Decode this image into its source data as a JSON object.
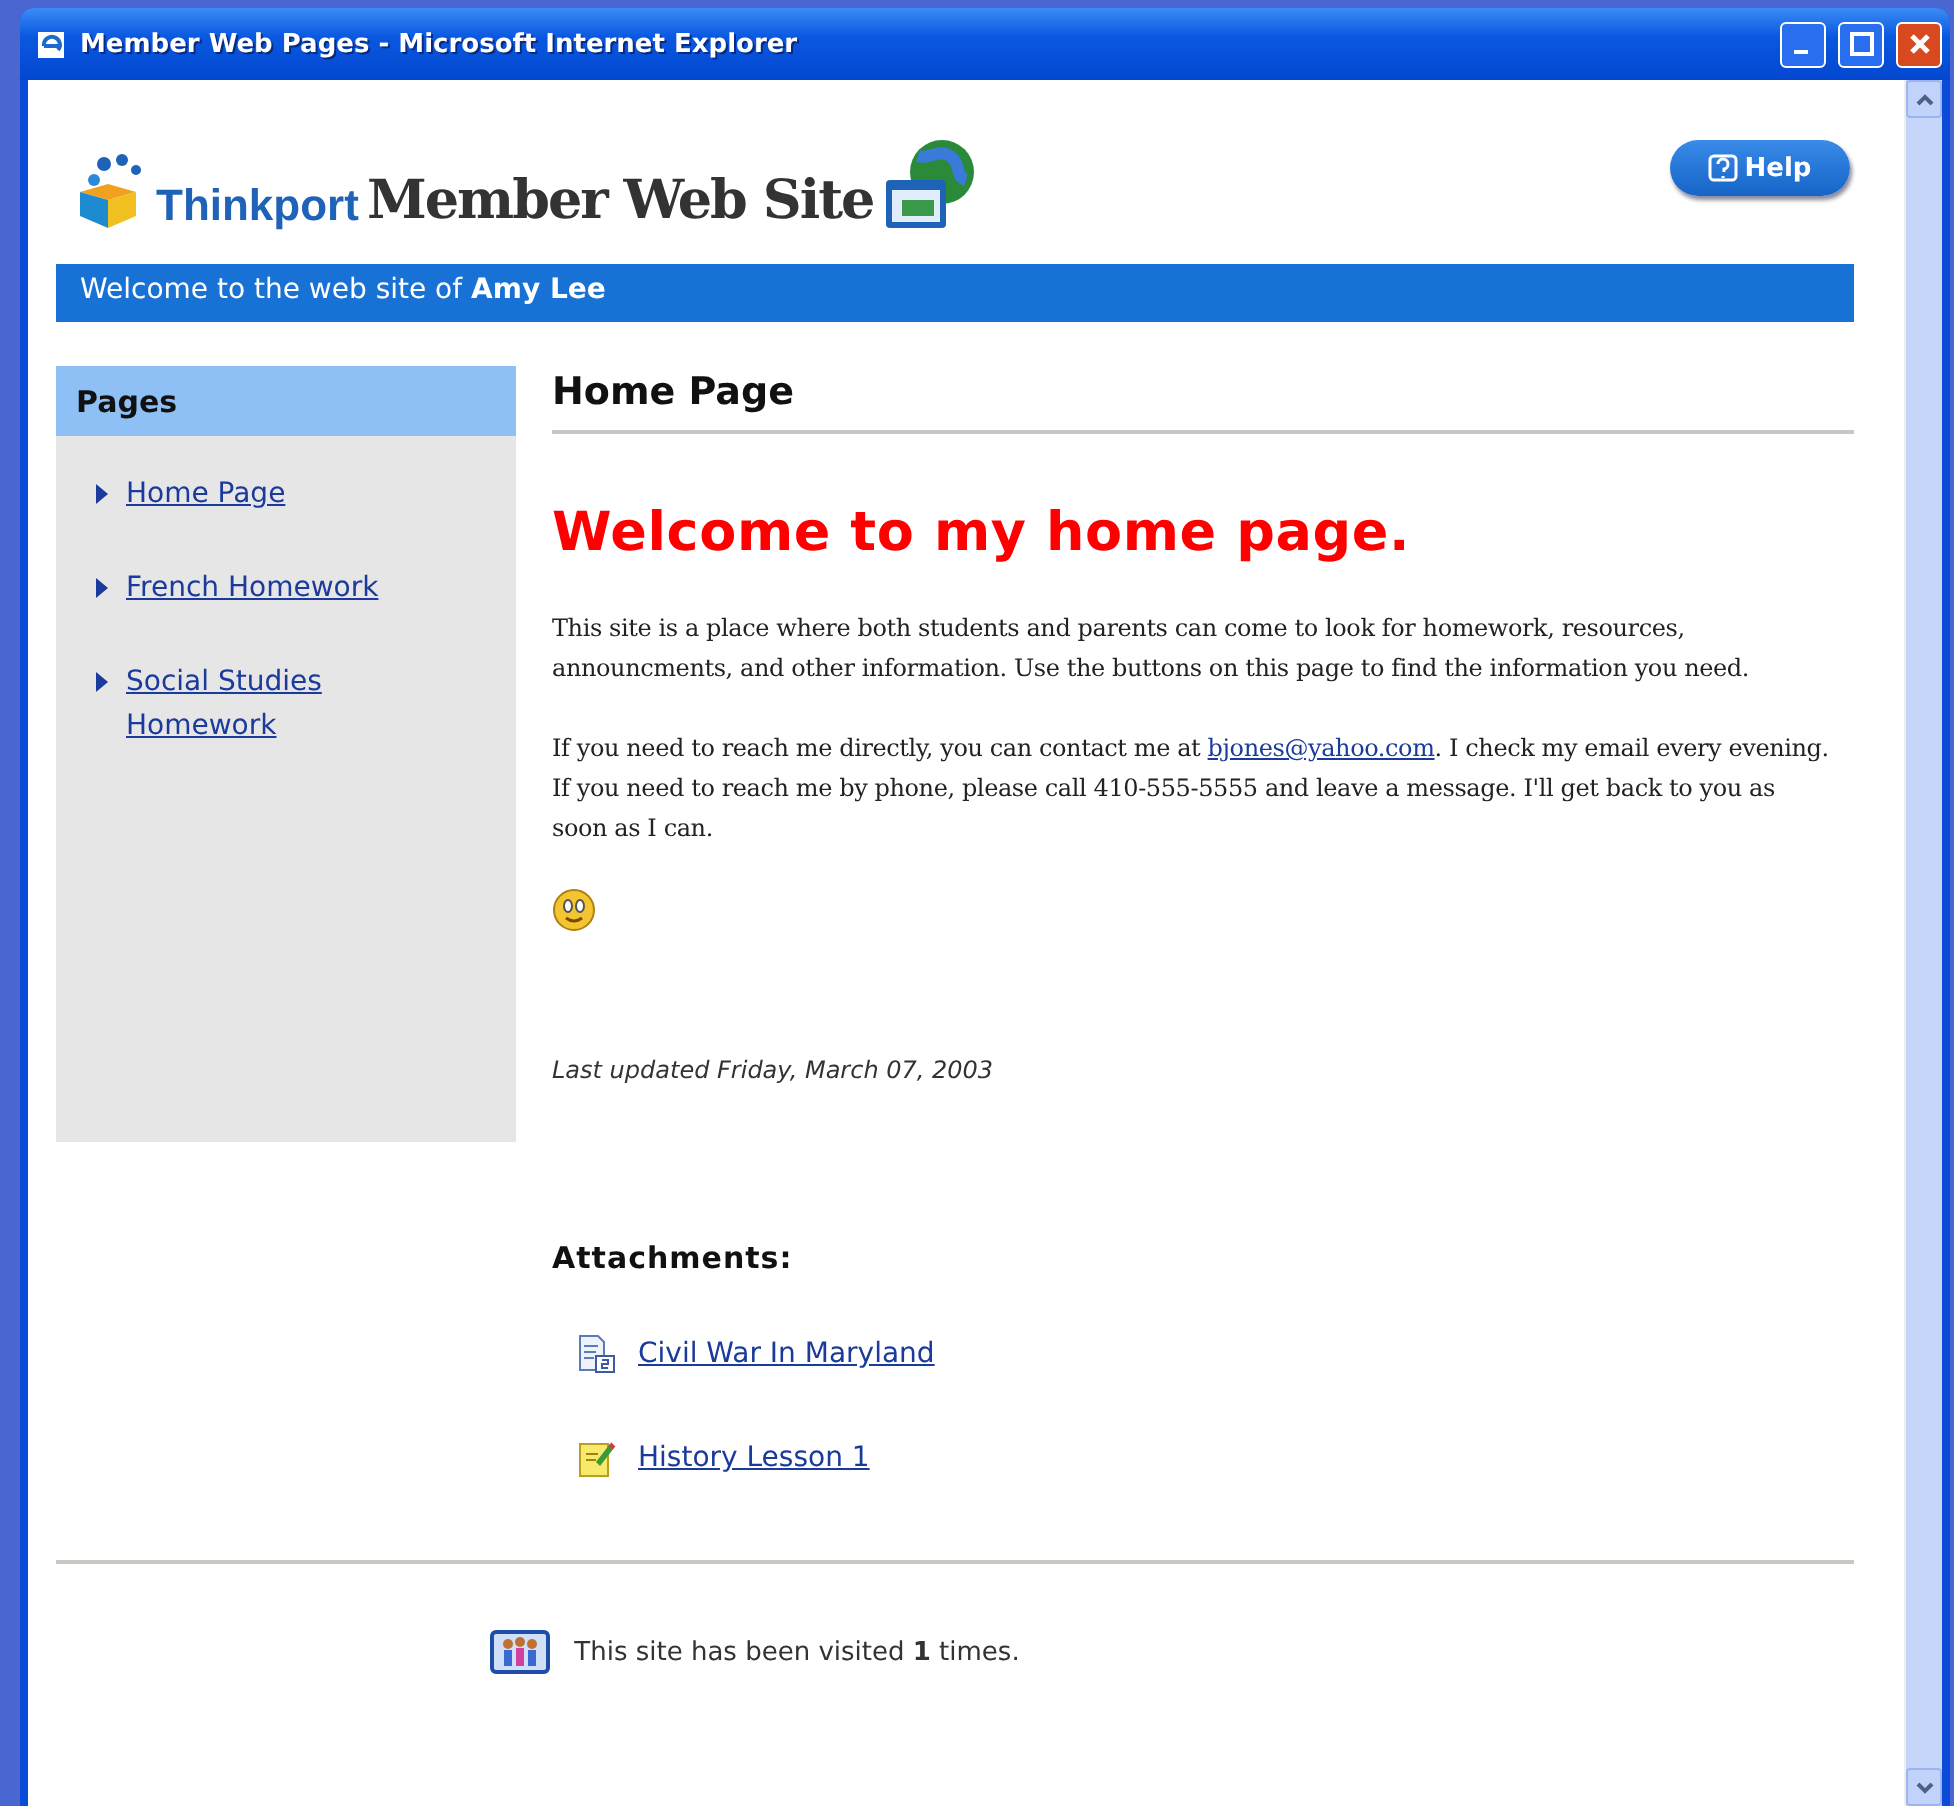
{
  "window": {
    "title": "Member Web Pages - Microsoft Internet Explorer"
  },
  "header": {
    "brand": "Thinkport",
    "site_title": "Member Web Site",
    "help_button": "Help"
  },
  "welcome_bar": "Welcome to the web site of **Amy Lee**",
  "sidebar": {
    "title": "Pages",
    "items": [
      {
        "label": "Home Page"
      },
      {
        "label": "French Homework"
      },
      {
        "label": "Social Studies Homework"
      }
    ]
  },
  "main": {
    "heading": "Home Page",
    "welcome": "Welcome to my home page.",
    "paragraphs": [
      {
        "text": "This site is a place where both students and parents can come to look for homework, resources, announcments, and other information. Use the buttons on this page to find the information you need."
      },
      {
        "text": "If you need to reach me directly, you can contact me at ",
        "link": "bjones@yahoo.com",
        "after": ". I check my email every evening. If you need to reach me by phone, please call 410-555-5555 and leave a message. I'll get back to you as soon as I can."
      }
    ],
    "last_updated": "Last updated Friday, March 07, 2003",
    "attachments_title": "Attachments:",
    "attachments": [
      {
        "kind": "document",
        "label": "Civil War In Maryland"
      },
      {
        "kind": "note",
        "label": "History Lesson 1"
      }
    ]
  },
  "footer": {
    "counter": "This site has been visited **1** times."
  }
}
